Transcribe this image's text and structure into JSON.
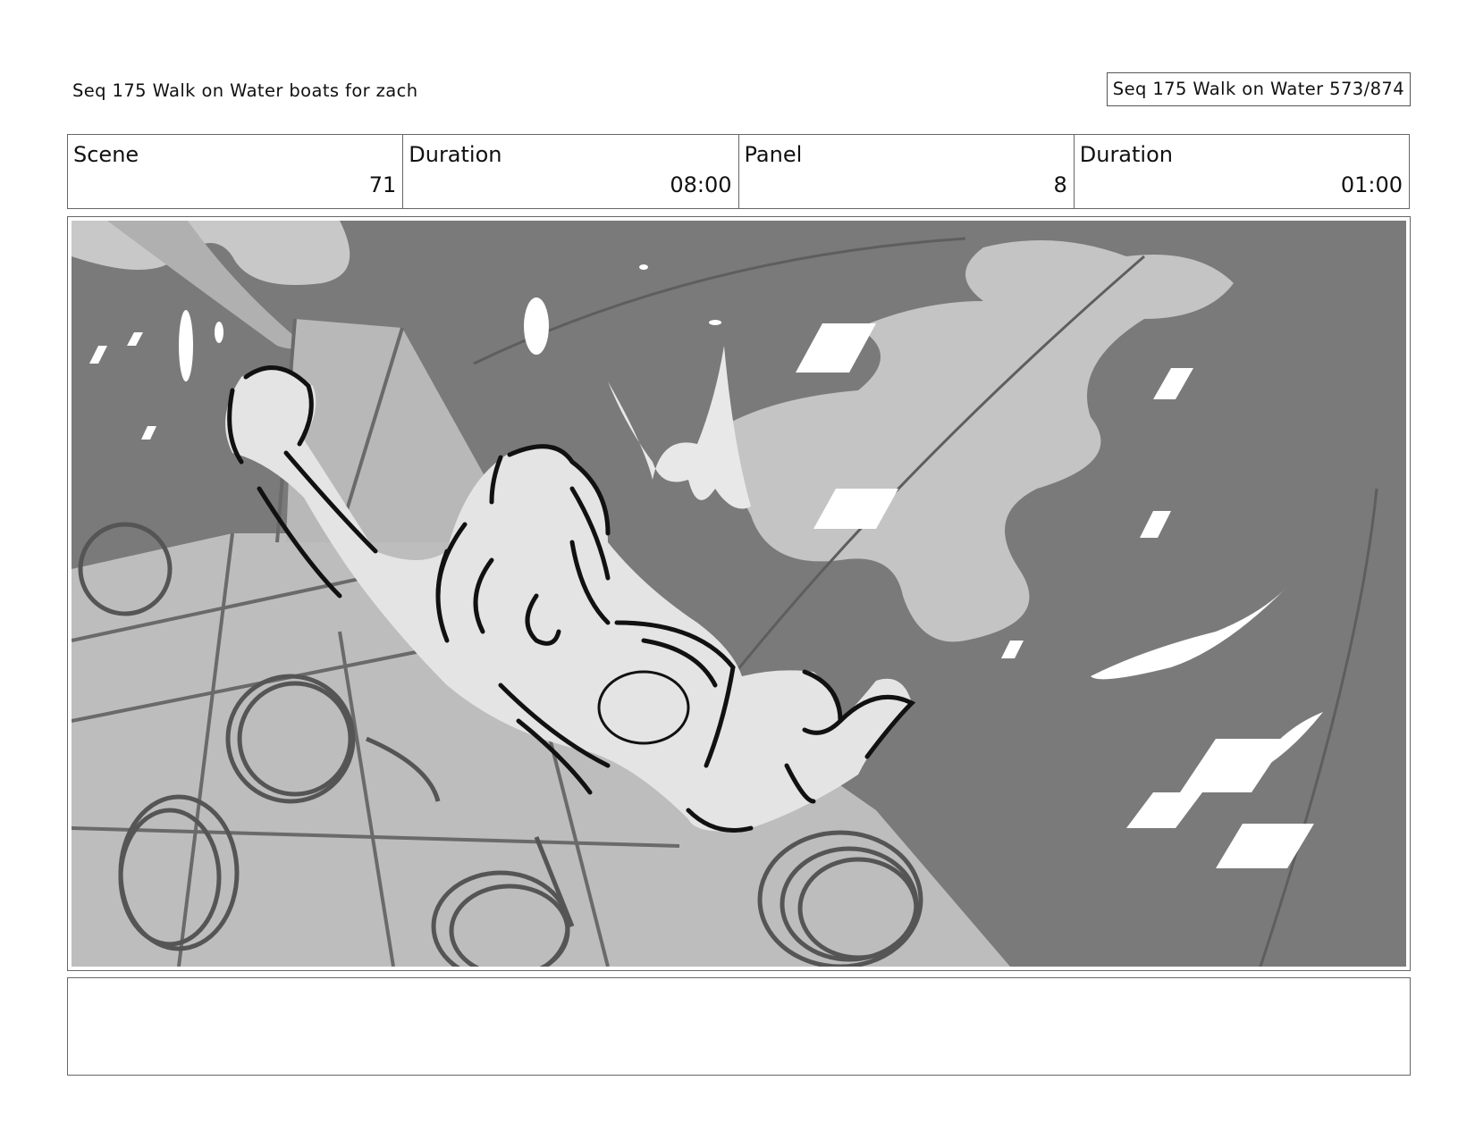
{
  "header": {
    "title": "Seq 175 Walk on Water  boats for zach",
    "page_ref": "Seq 175 Walk on Water 573/874"
  },
  "info": {
    "scene_label": "Scene",
    "scene_value": "71",
    "scene_duration_label": "Duration",
    "scene_duration_value": "08:00",
    "panel_label": "Panel",
    "panel_value": "8",
    "panel_duration_label": "Duration",
    "panel_duration_value": "01:00"
  },
  "notes": {
    "text": ""
  },
  "colors": {
    "sky_dark": "#7a7a7a",
    "cloud": "#c4c4c4",
    "deck": "#bdbdbd",
    "figure": "#e4e4e4",
    "ink": "#111111"
  }
}
